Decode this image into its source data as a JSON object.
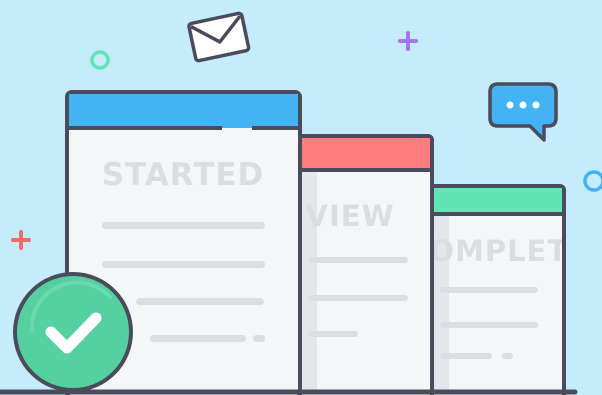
{
  "cards": [
    {
      "title": "STARTED",
      "header_color": "#44b3f3"
    },
    {
      "title": "REVIEW",
      "header_color": "#fd7c7c"
    },
    {
      "title": "COMPLETE",
      "header_color": "#62e5b4"
    }
  ],
  "colors": {
    "background": "#c5ecfb",
    "outline": "#4a4c5c",
    "card_body": "#f5f6f8",
    "line": "#dcdde2",
    "check_badge": "#55d0a0",
    "chat_bubble": "#44b3f3",
    "plus_purple": "#a678f0",
    "plus_red": "#f56b6b",
    "circle_green": "#62e5b4",
    "circle_blue": "#44b3f3"
  },
  "icons": [
    "envelope-icon",
    "chat-bubble-icon",
    "checkmark-icon",
    "plus-icon",
    "circle-icon"
  ]
}
